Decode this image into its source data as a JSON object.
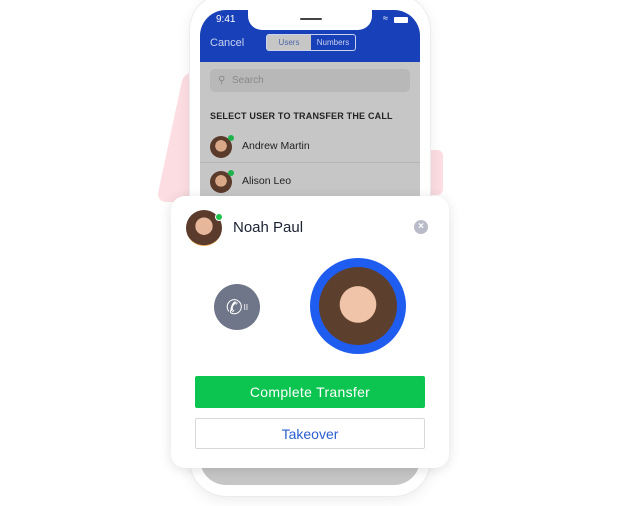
{
  "status_bar": {
    "time": "9:41",
    "wifi_icon": "wifi-icon",
    "battery_icon": "battery-icon"
  },
  "header": {
    "cancel": "Cancel",
    "tabs": [
      {
        "label": "Users",
        "selected": true
      },
      {
        "label": "Numbers",
        "selected": false
      }
    ]
  },
  "search": {
    "placeholder": "Search"
  },
  "section_title": "SELECT USER TO TRANSFER THE CALL",
  "users": [
    {
      "name": "Andrew Martin",
      "online": true
    },
    {
      "name": "Alison Leo",
      "online": true
    }
  ],
  "transfer_card": {
    "name": "Noah Paul",
    "online": true,
    "hold_icon": "phone-hold-icon",
    "complete_label": "Complete Transfer",
    "takeover_label": "Takeover"
  },
  "colors": {
    "header": "#1840b8",
    "accent": "#1f5cf0",
    "complete": "#0cc450",
    "online": "#1bc34a"
  }
}
